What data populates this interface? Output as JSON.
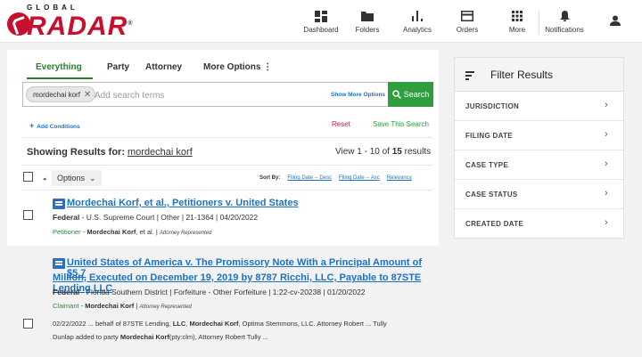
{
  "brand": {
    "top": "GLOBAL",
    "name": "RADAR",
    "registered": "®"
  },
  "nav": [
    {
      "label": "Dashboard",
      "icon": "dashboard-icon"
    },
    {
      "label": "Folders",
      "icon": "folder-icon"
    },
    {
      "label": "Analytics",
      "icon": "analytics-icon"
    },
    {
      "label": "Orders",
      "icon": "orders-icon"
    },
    {
      "label": "More",
      "icon": "grid-icon"
    },
    {
      "label": "Notifications",
      "icon": "bell-icon"
    }
  ],
  "tabs": [
    "Everything",
    "Party",
    "Attorney",
    "More Options"
  ],
  "search": {
    "chip": "mordechai korf",
    "placeholder": "Add search terms",
    "show_more": "Show More Options",
    "button": "Search"
  },
  "actions": {
    "add_conditions": "Add Conditions",
    "reset": "Reset",
    "save": "Save This Search"
  },
  "results_header": {
    "showing_label": "Showing Results for:",
    "query": "mordechai korf",
    "view_prefix": "View 1 - 10 of",
    "total": "15",
    "view_suffix": "results"
  },
  "toolbar": {
    "options": "Options",
    "sort_label": "Sort By:",
    "sort_options": [
      "Filing Date -- Desc",
      "Filing Date -- Asc",
      "Relevancy"
    ]
  },
  "results": [
    {
      "title": "Mordechai Korf, et al., Petitioners v. United States",
      "meta_prefix": "Federal",
      "meta_rest": " - U.S. Supreme Court | Other | 21-1364 | 04/20/2022",
      "role": "Petitioner",
      "party_name": "Mordechai Korf",
      "party_suffix": ", et al.",
      "attorney": "Attorney Represented"
    },
    {
      "title_line1": "United States of America v. The Promissory Note With a Principal Amount of $5.7",
      "title_line2": "Million, Executed on December 19, 2019 by 8787 Ricchi, LLC, Payable to 87STE Lending LLC",
      "meta_prefix": "Federal",
      "meta_rest": " - Florida Southern District | Forfeiture - Other Forfeiture | 1:22-cv-20238 | 01/20/2022",
      "role": "Claimant",
      "party_name": "Mordechai Korf",
      "attorney": "Attorney Represented",
      "snippet": {
        "line1_a": "02/22/2022  ... behalf of 87STE Lending, ",
        "line1_b": "LLC",
        "line1_c": ", ",
        "line1_d": "Mordechai Korf",
        "line1_e": ", Optima Stemmons, LLC. Attorney Robert ... Tully",
        "line2_a": "Dunlap added to party ",
        "line2_b": "Mordechai Korf",
        "line2_c": "(pty:clm), Attorney Robert Tully ..."
      }
    }
  ],
  "filter": {
    "title": "Filter Results",
    "items": [
      "JURISDICTION",
      "FILING DATE",
      "CASE TYPE",
      "CASE STATUS",
      "CREATED DATE"
    ]
  },
  "colors": {
    "brand_red": "#c8102e",
    "accent_green": "#2e9e3e",
    "link_blue": "#1a73c8"
  }
}
